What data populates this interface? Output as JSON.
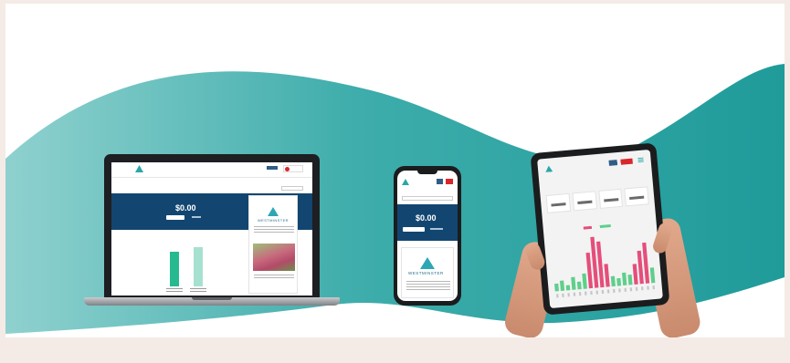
{
  "colors": {
    "teal_wave": "#34a9a8",
    "navy_banner": "#124670",
    "bar_green": "#27b98f",
    "bar_pink": "#e54e7b",
    "brand_teal": "#2aa7a6"
  },
  "laptop": {
    "amount": "$0.00",
    "brand_name": "WESTMINSTER",
    "bars": [
      40,
      45
    ]
  },
  "phone": {
    "amount": "$0.00",
    "brand_name": "WESTMINSTER"
  },
  "tablet": {
    "chart_bars": [
      {
        "v": 3,
        "c": "green"
      },
      {
        "v": 4,
        "c": "green"
      },
      {
        "v": 2,
        "c": "green"
      },
      {
        "v": 5,
        "c": "green"
      },
      {
        "v": 3,
        "c": "green"
      },
      {
        "v": 6,
        "c": "green"
      },
      {
        "v": 14,
        "c": "pink"
      },
      {
        "v": 20,
        "c": "pink"
      },
      {
        "v": 18,
        "c": "pink"
      },
      {
        "v": 9,
        "c": "pink"
      },
      {
        "v": 4,
        "c": "green"
      },
      {
        "v": 3,
        "c": "green"
      },
      {
        "v": 5,
        "c": "green"
      },
      {
        "v": 4,
        "c": "green"
      },
      {
        "v": 8,
        "c": "pink"
      },
      {
        "v": 13,
        "c": "pink"
      },
      {
        "v": 16,
        "c": "pink"
      },
      {
        "v": 6,
        "c": "green"
      }
    ]
  }
}
